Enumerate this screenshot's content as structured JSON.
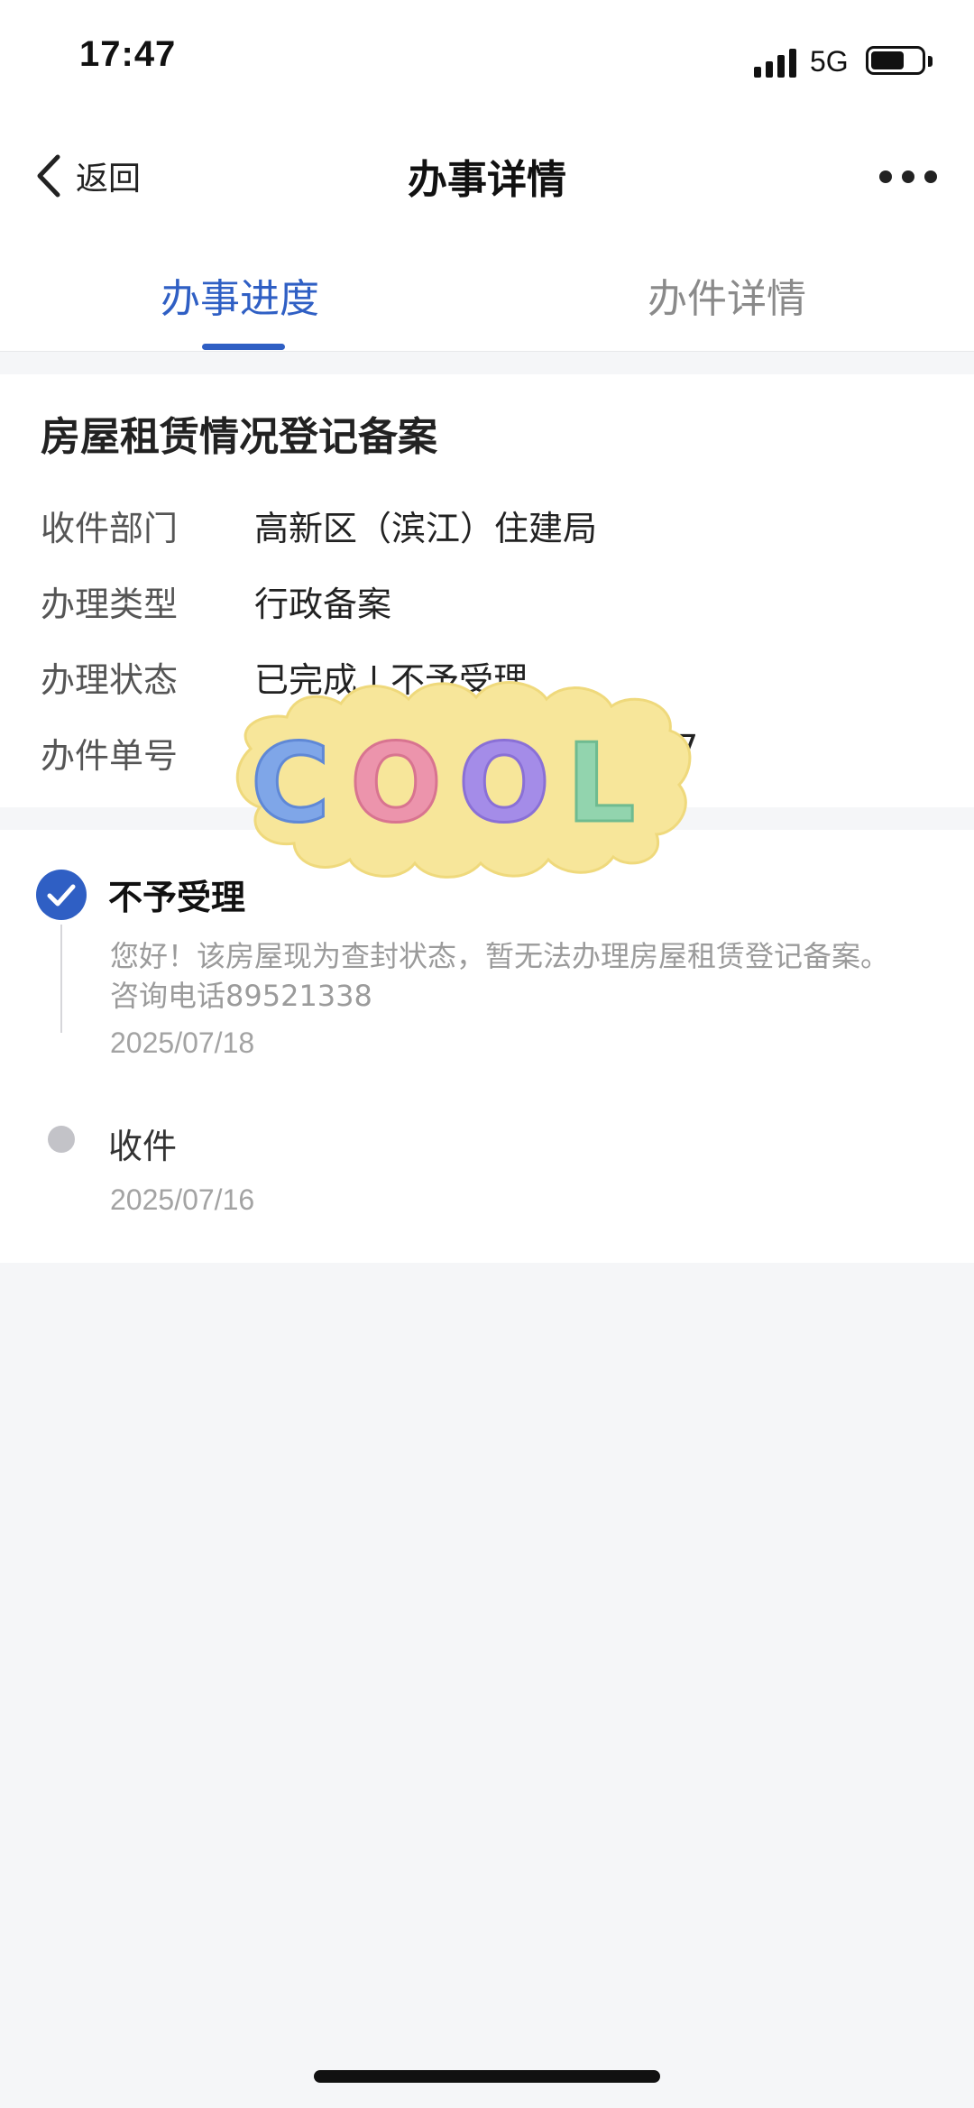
{
  "status_bar": {
    "time": "17:47",
    "network": "5G",
    "icons": [
      "signal-icon",
      "battery-icon"
    ]
  },
  "nav": {
    "back_label": "返回",
    "title": "办事详情",
    "more_icon": "more-dots-icon"
  },
  "tabs": [
    {
      "label": "办事进度",
      "active": true
    },
    {
      "label": "办件详情",
      "active": false
    }
  ],
  "colors": {
    "accent": "#2f5fc4",
    "muted": "#9b9b9b"
  },
  "case": {
    "title": "房屋租赁情况登记备案",
    "rows": [
      {
        "label": "收件部门",
        "value": "高新区（滨江）住建局"
      },
      {
        "label": "办理类型",
        "value": "行政备案"
      },
      {
        "label": "办理状态",
        "value": "已完成 | 不予受理"
      },
      {
        "label": "办件单号",
        "value": "7"
      }
    ]
  },
  "sticker": {
    "text": "COOL",
    "letters": [
      "C",
      "O",
      "O",
      "L"
    ]
  },
  "timeline": [
    {
      "title": "不予受理",
      "description": "您好！该房屋现为查封状态，暂无法办理房屋租赁登记备案。咨询电话89521338",
      "date": "2025/07/18",
      "status": "done",
      "icon": "check-circle-icon"
    },
    {
      "title": "收件",
      "description": "",
      "date": "2025/07/16",
      "status": "pending",
      "icon": "dot-icon"
    }
  ]
}
